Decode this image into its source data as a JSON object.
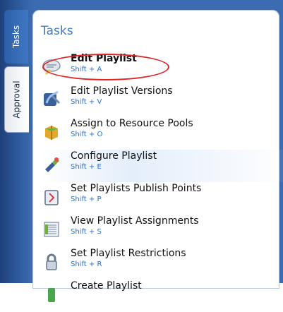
{
  "tabs": [
    {
      "label": "Tasks"
    },
    {
      "label": "Approval"
    }
  ],
  "panel": {
    "title": "Tasks",
    "items": [
      {
        "label": "Edit Playlist",
        "shortcut": "Shift + A",
        "icon": "edit-playlist-icon"
      },
      {
        "label": "Edit Playlist Versions",
        "shortcut": "Shift + V",
        "icon": "playlist-versions-icon"
      },
      {
        "label": "Assign to Resource Pools",
        "shortcut": "Shift + O",
        "icon": "resource-pools-icon"
      },
      {
        "label": "Configure Playlist",
        "shortcut": "Shift + E",
        "icon": "configure-playlist-icon"
      },
      {
        "label": "Set Playlists Publish Points",
        "shortcut": "Shift + P",
        "icon": "publish-points-icon"
      },
      {
        "label": "View Playlist Assignments",
        "shortcut": "Shift + S",
        "icon": "playlist-assignments-icon"
      },
      {
        "label": "Set Playlist Restrictions",
        "shortcut": "Shift + R",
        "icon": "restrictions-icon"
      },
      {
        "label": "Create Playlist",
        "shortcut": "",
        "icon": "create-playlist-icon"
      }
    ]
  },
  "colors": {
    "accent": "#3f79c7",
    "shortcut": "#2a6fcf",
    "highlight": "#e02222"
  }
}
